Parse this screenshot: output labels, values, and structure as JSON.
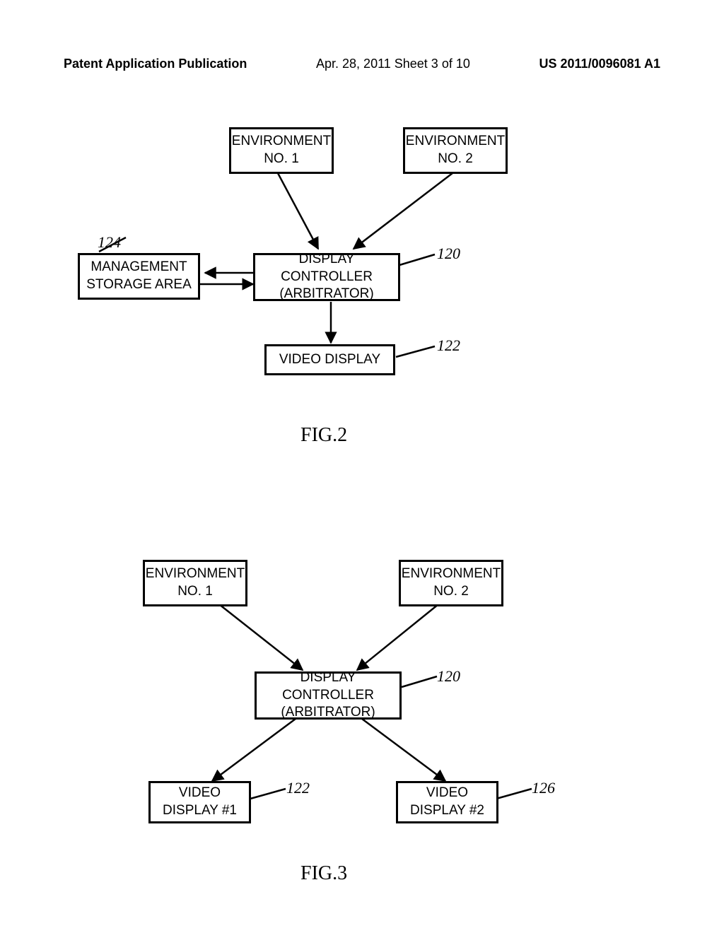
{
  "header": {
    "left": "Patent Application Publication",
    "center": "Apr. 28, 2011  Sheet 3 of 10",
    "right": "US 2011/0096081 A1"
  },
  "fig2": {
    "env1": "ENVIRONMENT\nNO. 1",
    "env2": "ENVIRONMENT\nNO. 2",
    "mgmt": "MANAGEMENT\nSTORAGE AREA",
    "ctrl": "DISPLAY CONTROLLER\n(ARBITRATOR)",
    "video": "VIDEO DISPLAY",
    "ref124": "124",
    "ref120": "120",
    "ref122": "122",
    "caption": "FIG.2"
  },
  "fig3": {
    "env1": "ENVIRONMENT\nNO. 1",
    "env2": "ENVIRONMENT\nNO. 2",
    "ctrl": "DISPLAY CONTROLLER\n(ARBITRATOR)",
    "v1": "VIDEO\nDISPLAY #1",
    "v2": "VIDEO\nDISPLAY #2",
    "ref120": "120",
    "ref122": "122",
    "ref126": "126",
    "caption": "FIG.3"
  }
}
